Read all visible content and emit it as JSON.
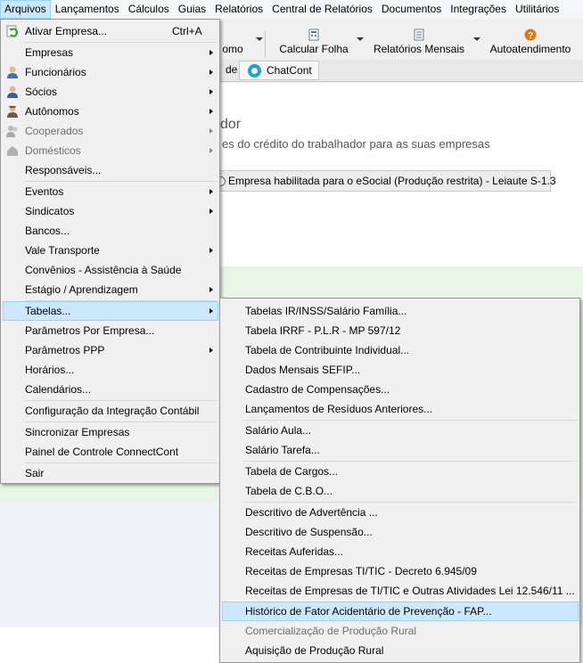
{
  "menubar": {
    "items": [
      "Arquivos",
      "Lançamentos",
      "Cálculos",
      "Guias",
      "Relatórios",
      "Central de Relatórios",
      "Documentos",
      "Integrações",
      "Utilitários"
    ]
  },
  "toolbar": {
    "partial_label": "omo",
    "calcular_folha": "Calcular Folha",
    "relatorios_mensais": "Relatórios Mensais",
    "autoatendimento": "Autoatendimento"
  },
  "tabs": {
    "partial_label": "de",
    "chat": "ChatCont"
  },
  "content": {
    "title_fragment": "dor",
    "subtitle_fragment": "es do crédito do trabalhador para as suas empresas",
    "status": "Empresa habilitada para o eSocial (Produção restrita) - Leiaute S-1.3"
  },
  "arquivos_menu": {
    "items": [
      {
        "label": "Ativar Empresa...",
        "shortcut": "Ctrl+A"
      },
      {
        "label": "Empresas"
      },
      {
        "label": "Funcionários"
      },
      {
        "label": "Sócios"
      },
      {
        "label": "Autônomos"
      },
      {
        "label": "Cooperados"
      },
      {
        "label": "Domésticos"
      },
      {
        "label": "Responsáveis..."
      },
      {
        "label": "Eventos"
      },
      {
        "label": "Sindicatos"
      },
      {
        "label": "Bancos..."
      },
      {
        "label": "Vale Transporte"
      },
      {
        "label": "Convênios - Assistência à Saúde"
      },
      {
        "label": "Estágio / Aprendizagem"
      },
      {
        "label": "Tabelas..."
      },
      {
        "label": "Parâmetros Por Empresa..."
      },
      {
        "label": "Parâmetros PPP"
      },
      {
        "label": "Horários..."
      },
      {
        "label": "Calendários..."
      },
      {
        "label": "Configuração da Integração Contábil"
      },
      {
        "label": "Sincronizar Empresas"
      },
      {
        "label": "Painel de Controle ConnectCont"
      },
      {
        "label": "Sair"
      }
    ]
  },
  "tabelas_submenu": {
    "items": [
      {
        "label": "Tabelas IR/INSS/Salário Família..."
      },
      {
        "label": "Tabela IRRF - P.L.R - MP 597/12"
      },
      {
        "label": "Tabela de Contribuinte Individual..."
      },
      {
        "label": "Dados Mensais SEFIP..."
      },
      {
        "label": "Cadastro de Compensações..."
      },
      {
        "label": "Lançamentos de Resíduos Anteriores..."
      },
      {
        "label": "Salário Aula..."
      },
      {
        "label": "Salário Tarefa..."
      },
      {
        "label": "Tabela de Cargos..."
      },
      {
        "label": "Tabela de C.B.O..."
      },
      {
        "label": "Descritivo de Advertência ..."
      },
      {
        "label": "Descritivo de Suspensão..."
      },
      {
        "label": "Receitas Auferidas..."
      },
      {
        "label": "Receitas de Empresas TI/TIC - Decreto 6.945/09"
      },
      {
        "label": "Receitas de Empresas de TI/TIC e Outras Atividades Lei 12.546/11 ..."
      },
      {
        "label": "Histórico de Fator Acidentário de Prevenção - FAP..."
      },
      {
        "label": "Comercialização de Produção Rural"
      },
      {
        "label": "Aquisição de Produção Rural"
      }
    ]
  },
  "colors": {
    "highlight": "#cce8ff",
    "highlight_border": "#99d1ff",
    "menu_bg": "#f0f0f0",
    "disabled_text": "#6d6d6d",
    "accent_orange": "#e8720c",
    "chat_blue": "#1aa3d9",
    "green_band": "#e8f4e6"
  },
  "icons": {
    "ativar_empresa": "refresh-green-arrow-icon",
    "funcionarios": "person-blue-icon",
    "socios": "person-blue-icon",
    "autonomos": "person-worker-icon",
    "cooperados": "people-disabled-icon",
    "domesticos": "house-disabled-icon",
    "calcular_folha": "calculator-doc-icon",
    "relatorios_mensais": "document-list-icon",
    "autoatendimento": "help-orange-icon",
    "chat": "chat-bubble-icon"
  }
}
